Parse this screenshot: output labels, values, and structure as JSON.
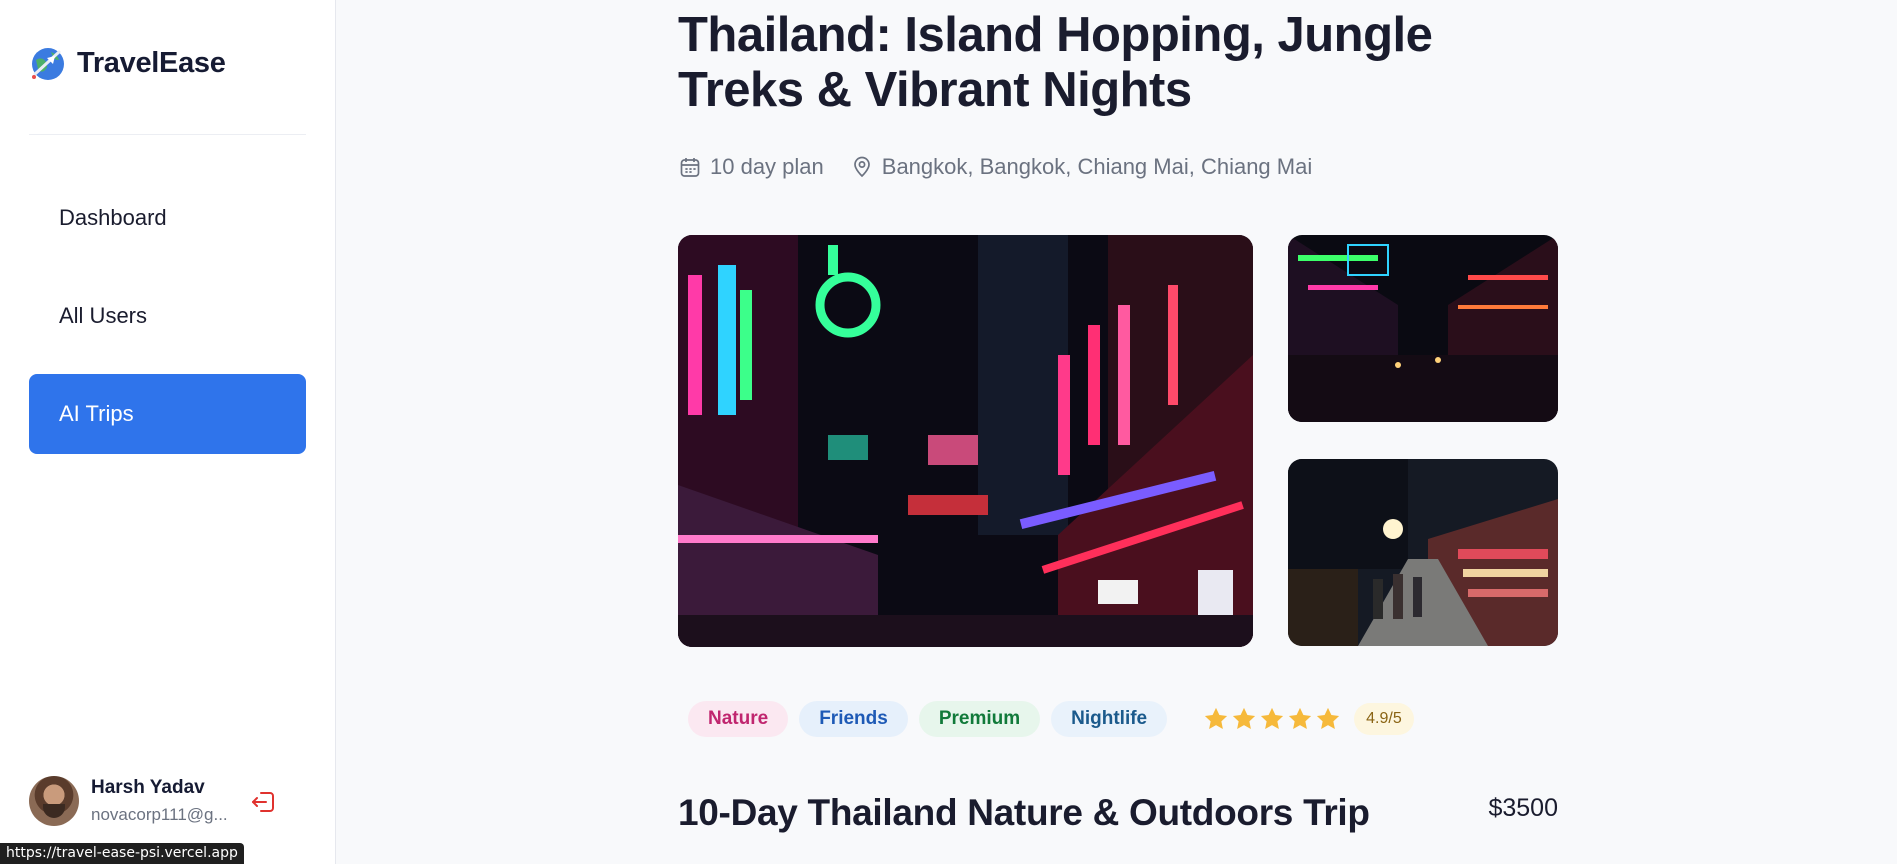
{
  "brand": {
    "name": "TravelEase",
    "logo_icon": "globe-plane-icon"
  },
  "sidebar": {
    "items": [
      {
        "label": "Dashboard",
        "active": false
      },
      {
        "label": "All Users",
        "active": false
      },
      {
        "label": "AI Trips",
        "active": true
      }
    ],
    "user": {
      "name": "Harsh Yadav",
      "email": "novacorp111@g...",
      "logout_icon": "logout-icon"
    }
  },
  "status_bar": {
    "url": "https://travel-ease-psi.vercel.app"
  },
  "trip": {
    "title": "Thailand: Island Hopping, Jungle Treks & Vibrant Nights",
    "duration": "10 day plan",
    "locations": "Bangkok, Bangkok, Chiang Mai, Chiang Mai",
    "tags": [
      "Nature",
      "Friends",
      "Premium",
      "Nightlife"
    ],
    "rating": {
      "stars": 5,
      "label": "4.9/5"
    },
    "name": "10-Day Thailand Nature & Outdoors Trip",
    "price": "$3500"
  },
  "colors": {
    "accent": "#2f74eb",
    "star": "#f6b93b",
    "logout": "#e0322e"
  }
}
